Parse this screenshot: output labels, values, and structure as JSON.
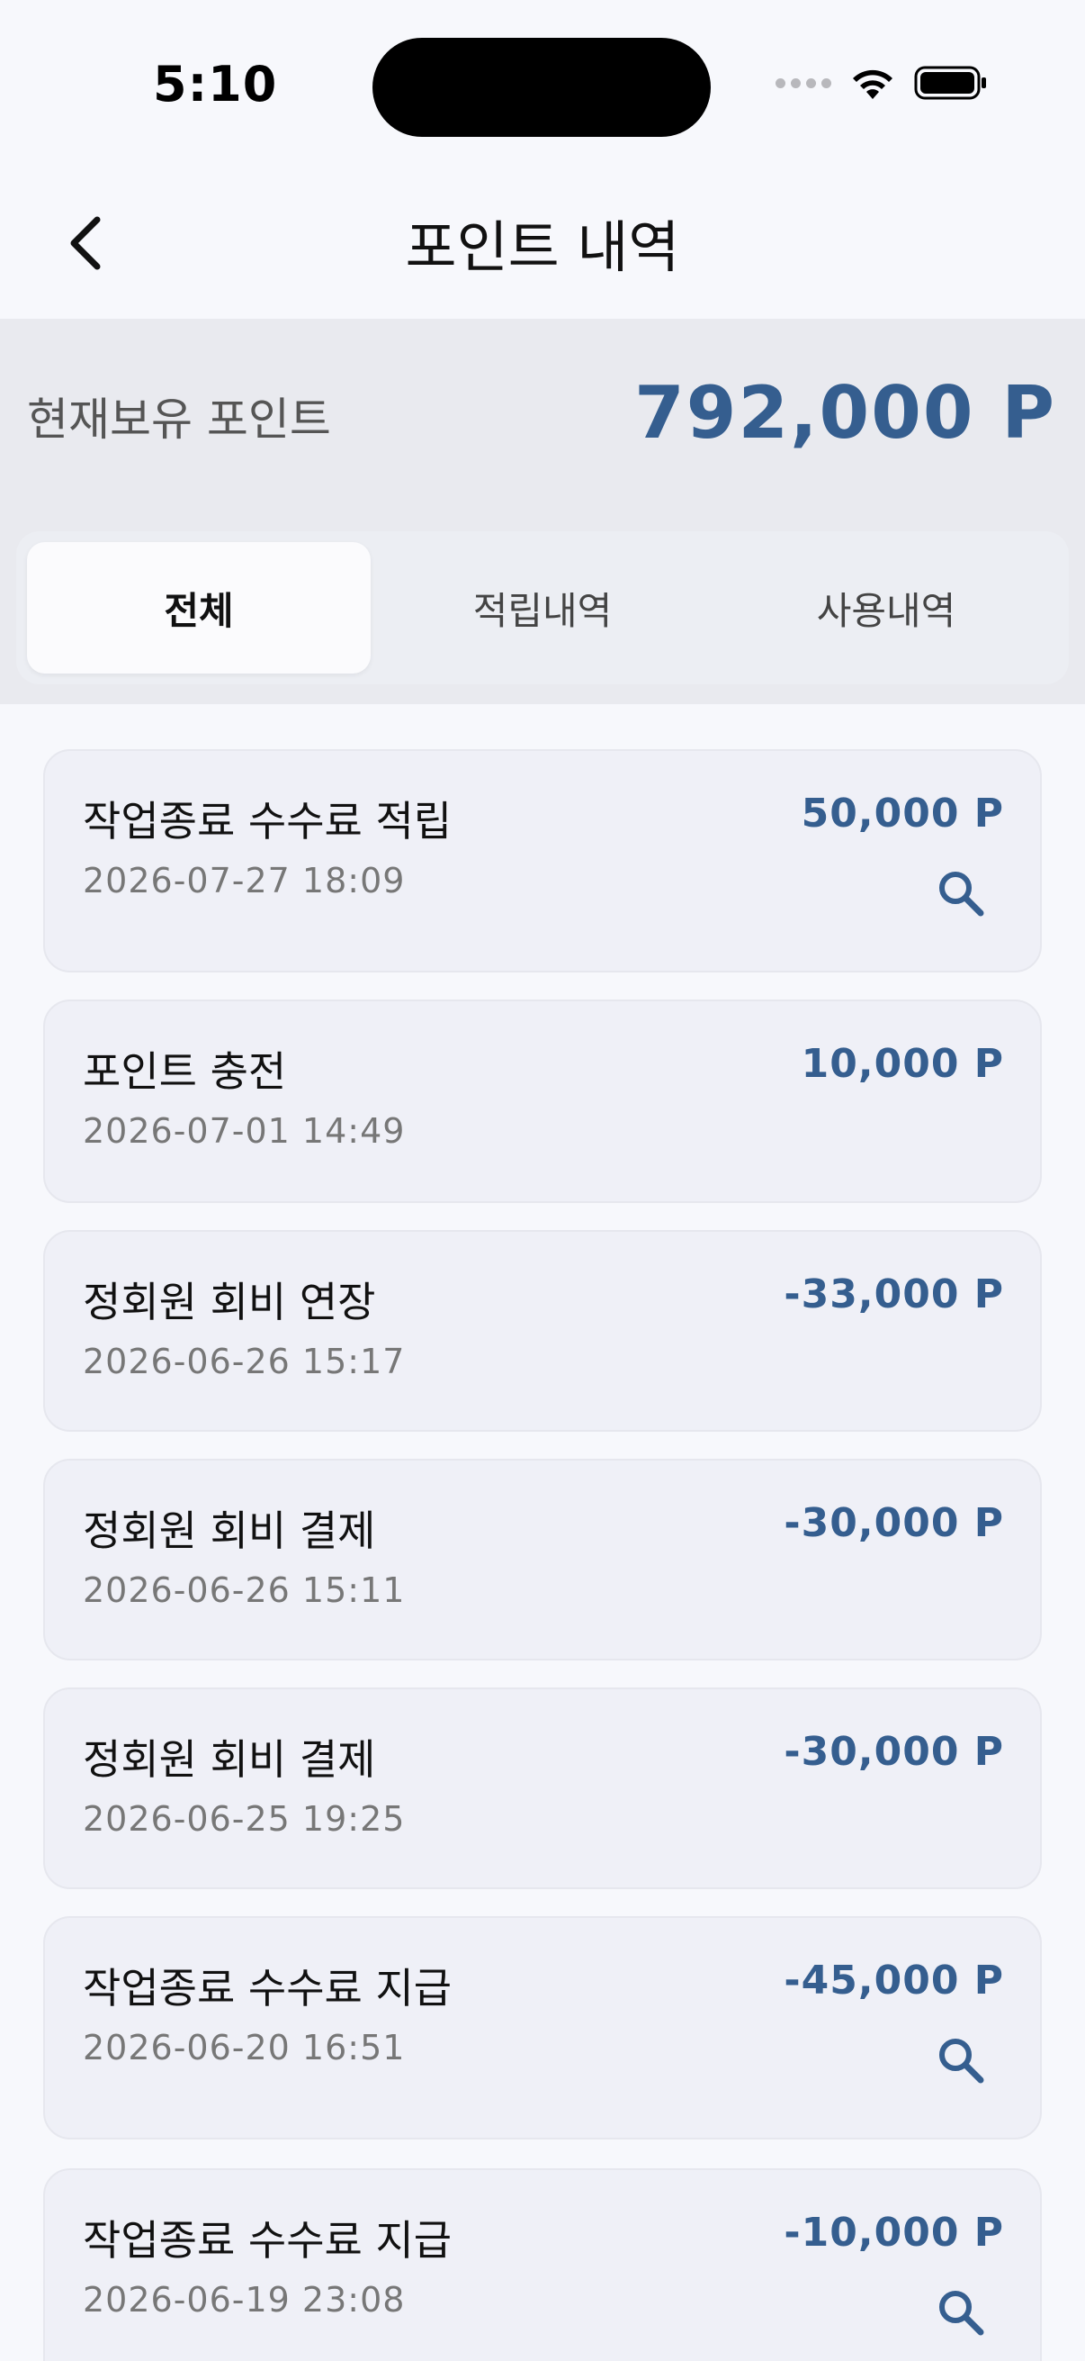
{
  "status_bar": {
    "time": "5:10"
  },
  "header": {
    "title": "포인트 내역",
    "back_icon": "chevron-left-icon"
  },
  "balance": {
    "label": "현재보유 포인트",
    "value": "792,000 P"
  },
  "tabs": [
    {
      "label": "전체",
      "active": true
    },
    {
      "label": "적립내역",
      "active": false
    },
    {
      "label": "사용내역",
      "active": false
    }
  ],
  "transactions": [
    {
      "title": "작업종료 수수료 적립",
      "date": "2026-07-27 18:09",
      "amount": "50,000 P",
      "has_detail": true
    },
    {
      "title": "포인트 충전",
      "date": "2026-07-01 14:49",
      "amount": "10,000 P",
      "has_detail": false
    },
    {
      "title": "정회원 회비 연장",
      "date": "2026-06-26 15:17",
      "amount": "-33,000 P",
      "has_detail": false
    },
    {
      "title": "정회원 회비 결제",
      "date": "2026-06-26 15:11",
      "amount": "-30,000 P",
      "has_detail": false
    },
    {
      "title": "정회원 회비 결제",
      "date": "2026-06-25 19:25",
      "amount": "-30,000 P",
      "has_detail": false
    },
    {
      "title": "작업종료 수수료 지급",
      "date": "2026-06-20 16:51",
      "amount": "-45,000 P",
      "has_detail": true
    },
    {
      "title": "작업종료 수수료 지급",
      "date": "2026-06-19 23:08",
      "amount": "-10,000 P",
      "has_detail": true
    }
  ],
  "colors": {
    "accent": "#355e8f",
    "card_bg": "#eff0f7",
    "section_bg": "#e9eaef"
  }
}
